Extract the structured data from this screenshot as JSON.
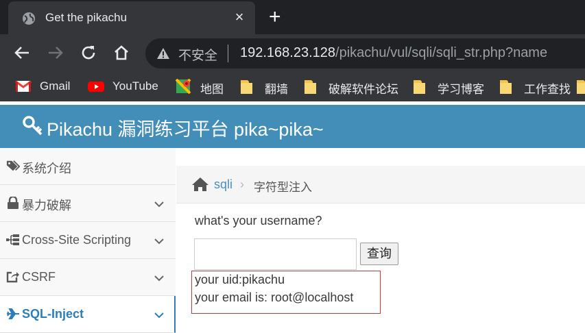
{
  "browser": {
    "tab_title": "Get the pikachu",
    "new_tab_symbol": "+",
    "close_symbol": "×",
    "security_label": "不安全",
    "url_host": "192.168.23.128",
    "url_path": "/pikachu/vul/sqli/sqli_str.php?name",
    "bookmarks": [
      {
        "label": "Gmail",
        "icon": "gmail-icon"
      },
      {
        "label": "YouTube",
        "icon": "youtube-icon"
      },
      {
        "label": "地图",
        "icon": "maps-icon"
      },
      {
        "label": "翻墙",
        "icon": "folder-icon"
      },
      {
        "label": "破解软件论坛",
        "icon": "folder-icon"
      },
      {
        "label": "学习博客",
        "icon": "folder-icon"
      },
      {
        "label": "工作查找",
        "icon": "folder-icon"
      }
    ]
  },
  "header": {
    "title": "Pikachu 漏洞练习平台 pika~pika~",
    "icon": "key-icon"
  },
  "sidebar": {
    "items": [
      {
        "label": "系统介绍",
        "icon": "tags-icon"
      },
      {
        "label": "暴力破解",
        "icon": "lock-icon"
      },
      {
        "label": "Cross-Site Scripting",
        "icon": "sitemap-icon"
      },
      {
        "label": "CSRF",
        "icon": "share-icon"
      },
      {
        "label": "SQL-Inject",
        "icon": "plane-icon"
      }
    ]
  },
  "breadcrumb": {
    "link": "sqli",
    "separator": "›",
    "current": "字符型注入"
  },
  "main": {
    "question": "what's your username?",
    "input_value": "",
    "query_button": "查询",
    "result_uid": "your uid:pikachu",
    "result_email": "your email is: root@localhost"
  },
  "colors": {
    "header_bg": "#438eb9",
    "active_link": "#2b7dbc",
    "result_border": "#dd3333"
  }
}
